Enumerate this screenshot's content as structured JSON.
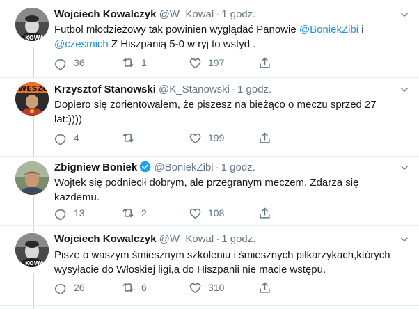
{
  "tweets": [
    {
      "name": "Wojciech Kowalczyk",
      "handle": "@W_Kowal",
      "time": "1 godz.",
      "verified": false,
      "text_segments": [
        {
          "t": "Futbol młodzieżowy tak powinien wyglądać Panowie "
        },
        {
          "t": "@BoniekZibi",
          "mention": true
        },
        {
          "t": "  i "
        },
        {
          "t": "@czesmich",
          "mention": true
        },
        {
          "t": " Z Hiszpanią 5-0 w  ryj to wstyd ."
        }
      ],
      "replies": "36",
      "retweets": "1",
      "likes": "197"
    },
    {
      "name": "Krzysztof Stanowski",
      "handle": "@K_Stanowski",
      "time": "1 godz.",
      "verified": false,
      "text_segments": [
        {
          "t": "Dopiero się zorientowałem, że piszesz na bieżąco o meczu sprzed 27 lat:))))"
        }
      ],
      "replies": "4",
      "retweets": "",
      "likes": "199"
    },
    {
      "name": "Zbigniew Boniek",
      "handle": "@BoniekZibi",
      "time": "1 godz.",
      "verified": true,
      "text_segments": [
        {
          "t": "Wojtek się podniecił dobrym, ale przegranym meczem. Zdarza się każdemu."
        }
      ],
      "replies": "13",
      "retweets": "2",
      "likes": "108"
    },
    {
      "name": "Wojciech Kowalczyk",
      "handle": "@W_Kowal",
      "time": "1 godz.",
      "verified": false,
      "text_segments": [
        {
          "t": "Piszę o waszym śmiesznym szkoleniu i śmiesznych piłkarzykach,których wysyłacie do Włoskiej ligi,a do Hiszpanii nie macie wstępu."
        }
      ],
      "replies": "26",
      "retweets": "6",
      "likes": "310"
    }
  ],
  "separator": "·",
  "icons": [
    "reply-icon",
    "retweet-icon",
    "like-icon",
    "share-icon",
    "caret-down-icon",
    "verified-badge-icon"
  ],
  "colors": {
    "text": "#14171a",
    "muted": "#657786",
    "link": "#1b95e0",
    "divider": "#e6ecf0",
    "verified": "#1da1f2"
  }
}
